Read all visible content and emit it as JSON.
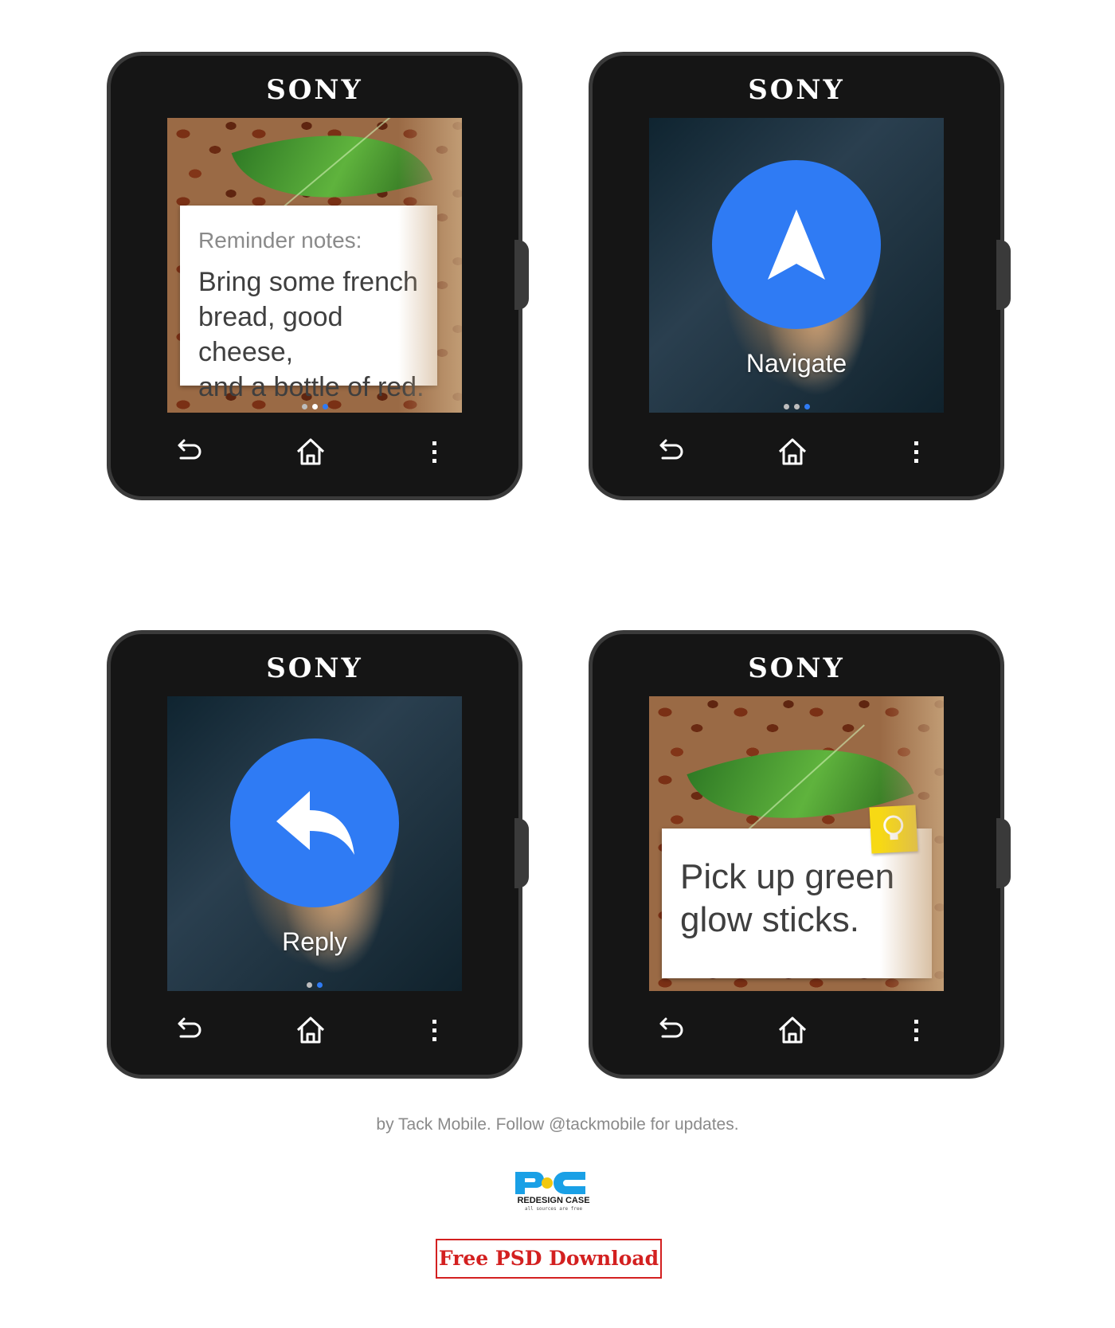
{
  "watches": [
    {
      "brand": "SONY",
      "card": {
        "subtitle": "Reminder notes:",
        "lines": [
          "Bring some french",
          "bread, good cheese,",
          "and a bottle of red."
        ]
      },
      "page_dots": {
        "count": 3,
        "active_index": 2
      }
    },
    {
      "brand": "SONY",
      "action": {
        "label": "Navigate",
        "icon": "navigation-arrow-icon"
      },
      "page_dots": {
        "count": 3,
        "active_index": 2
      }
    },
    {
      "brand": "SONY",
      "action": {
        "label": "Reply",
        "icon": "reply-arrow-icon"
      },
      "page_dots": {
        "count": 2,
        "active_index": 1
      }
    },
    {
      "brand": "SONY",
      "card": {
        "lines": [
          "Pick up green",
          "glow sticks."
        ],
        "icon": "keep-lightbulb-icon"
      }
    }
  ],
  "nav_icons": [
    "back-icon",
    "home-icon",
    "more-vert-icon"
  ],
  "footer": {
    "credit": "by Tack Mobile. Follow @tackmobile for updates.",
    "logo_text": "REDESIGN CASE",
    "logo_tagline": "all sources are free",
    "download_label": "Free PSD Download"
  },
  "colors": {
    "accent_blue": "#2f7bf4",
    "watch_body": "#151515",
    "download_red": "#d32020"
  }
}
